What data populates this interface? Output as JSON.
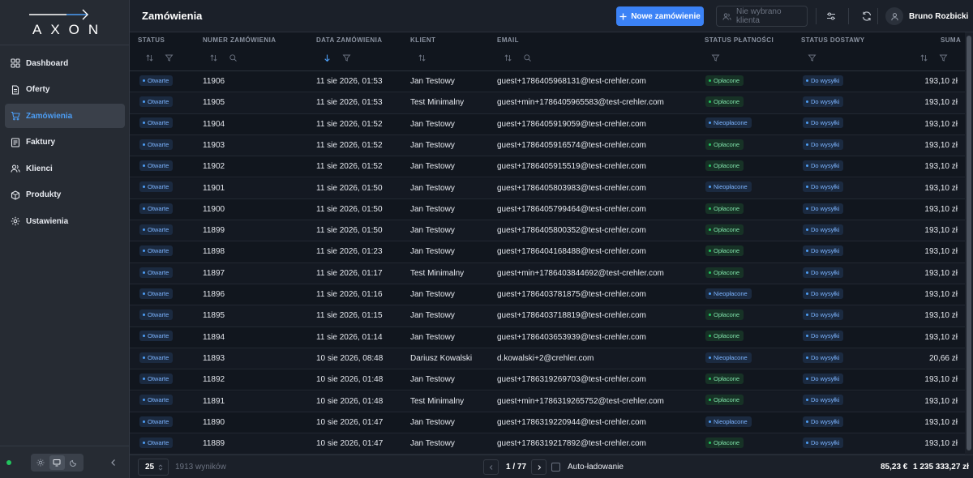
{
  "app": {
    "logo_text": "AXON"
  },
  "sidebar": {
    "items": [
      {
        "label": "Dashboard",
        "icon": "dashboard-icon",
        "active": false
      },
      {
        "label": "Oferty",
        "icon": "document-icon",
        "active": false
      },
      {
        "label": "Zamówienia",
        "icon": "cart-icon",
        "active": true
      },
      {
        "label": "Faktury",
        "icon": "invoice-icon",
        "active": false
      },
      {
        "label": "Klienci",
        "icon": "users-icon",
        "active": false
      },
      {
        "label": "Produkty",
        "icon": "package-icon",
        "active": false
      },
      {
        "label": "Ustawienia",
        "icon": "gear-icon",
        "active": false
      }
    ]
  },
  "header": {
    "title": "Zamówienia",
    "new_order_label": "Nowe zamówienie",
    "client_placeholder": "Nie wybrano klienta",
    "user_name": "Bruno Rozbicki"
  },
  "table": {
    "columns": {
      "status": "STATUS",
      "order_number": "NUMER ZAMÓWIENIA",
      "order_date": "DATA ZAMÓWIENIA",
      "client": "KLIENT",
      "email": "EMAIL",
      "payment_status": "STATUS PŁATNOŚCI",
      "delivery_status": "STATUS DOSTAWY",
      "sum": "SUMA"
    },
    "rows": [
      {
        "status": "Otwarte",
        "number": "11906",
        "date": "11 sie 2026, 01:53",
        "client": "Jan Testowy",
        "email": "guest+1786405968131@test-crehler.com",
        "payment": "Opłacone",
        "delivery": "Do wysyłki",
        "sum": "193,10 zł"
      },
      {
        "status": "Otwarte",
        "number": "11905",
        "date": "11 sie 2026, 01:53",
        "client": "Test Minimalny",
        "email": "guest+min+1786405965583@test-crehler.com",
        "payment": "Opłacone",
        "delivery": "Do wysyłki",
        "sum": "193,10 zł"
      },
      {
        "status": "Otwarte",
        "number": "11904",
        "date": "11 sie 2026, 01:52",
        "client": "Jan Testowy",
        "email": "guest+1786405919059@test-crehler.com",
        "payment": "Nieopłacone",
        "delivery": "Do wysyłki",
        "sum": "193,10 zł"
      },
      {
        "status": "Otwarte",
        "number": "11903",
        "date": "11 sie 2026, 01:52",
        "client": "Jan Testowy",
        "email": "guest+1786405916574@test-crehler.com",
        "payment": "Opłacone",
        "delivery": "Do wysyłki",
        "sum": "193,10 zł"
      },
      {
        "status": "Otwarte",
        "number": "11902",
        "date": "11 sie 2026, 01:52",
        "client": "Jan Testowy",
        "email": "guest+1786405915519@test-crehler.com",
        "payment": "Opłacone",
        "delivery": "Do wysyłki",
        "sum": "193,10 zł"
      },
      {
        "status": "Otwarte",
        "number": "11901",
        "date": "11 sie 2026, 01:50",
        "client": "Jan Testowy",
        "email": "guest+1786405803983@test-crehler.com",
        "payment": "Nieopłacone",
        "delivery": "Do wysyłki",
        "sum": "193,10 zł"
      },
      {
        "status": "Otwarte",
        "number": "11900",
        "date": "11 sie 2026, 01:50",
        "client": "Jan Testowy",
        "email": "guest+1786405799464@test-crehler.com",
        "payment": "Opłacone",
        "delivery": "Do wysyłki",
        "sum": "193,10 zł"
      },
      {
        "status": "Otwarte",
        "number": "11899",
        "date": "11 sie 2026, 01:50",
        "client": "Jan Testowy",
        "email": "guest+1786405800352@test-crehler.com",
        "payment": "Opłacone",
        "delivery": "Do wysyłki",
        "sum": "193,10 zł"
      },
      {
        "status": "Otwarte",
        "number": "11898",
        "date": "11 sie 2026, 01:23",
        "client": "Jan Testowy",
        "email": "guest+1786404168488@test-crehler.com",
        "payment": "Opłacone",
        "delivery": "Do wysyłki",
        "sum": "193,10 zł"
      },
      {
        "status": "Otwarte",
        "number": "11897",
        "date": "11 sie 2026, 01:17",
        "client": "Test Minimalny",
        "email": "guest+min+1786403844692@test-crehler.com",
        "payment": "Opłacone",
        "delivery": "Do wysyłki",
        "sum": "193,10 zł"
      },
      {
        "status": "Otwarte",
        "number": "11896",
        "date": "11 sie 2026, 01:16",
        "client": "Jan Testowy",
        "email": "guest+1786403781875@test-crehler.com",
        "payment": "Nieopłacone",
        "delivery": "Do wysyłki",
        "sum": "193,10 zł"
      },
      {
        "status": "Otwarte",
        "number": "11895",
        "date": "11 sie 2026, 01:15",
        "client": "Jan Testowy",
        "email": "guest+1786403718819@test-crehler.com",
        "payment": "Opłacone",
        "delivery": "Do wysyłki",
        "sum": "193,10 zł"
      },
      {
        "status": "Otwarte",
        "number": "11894",
        "date": "11 sie 2026, 01:14",
        "client": "Jan Testowy",
        "email": "guest+1786403653939@test-crehler.com",
        "payment": "Opłacone",
        "delivery": "Do wysyłki",
        "sum": "193,10 zł"
      },
      {
        "status": "Otwarte",
        "number": "11893",
        "date": "10 sie 2026, 08:48",
        "client": "Dariusz Kowalski",
        "email": "d.kowalski+2@crehler.com",
        "payment": "Nieopłacone",
        "delivery": "Do wysyłki",
        "sum": "20,66 zł"
      },
      {
        "status": "Otwarte",
        "number": "11892",
        "date": "10 sie 2026, 01:48",
        "client": "Jan Testowy",
        "email": "guest+1786319269703@test-crehler.com",
        "payment": "Opłacone",
        "delivery": "Do wysyłki",
        "sum": "193,10 zł"
      },
      {
        "status": "Otwarte",
        "number": "11891",
        "date": "10 sie 2026, 01:48",
        "client": "Test Minimalny",
        "email": "guest+min+1786319265752@test-crehler.com",
        "payment": "Opłacone",
        "delivery": "Do wysyłki",
        "sum": "193,10 zł"
      },
      {
        "status": "Otwarte",
        "number": "11890",
        "date": "10 sie 2026, 01:47",
        "client": "Jan Testowy",
        "email": "guest+1786319220944@test-crehler.com",
        "payment": "Nieopłacone",
        "delivery": "Do wysyłki",
        "sum": "193,10 zł"
      },
      {
        "status": "Otwarte",
        "number": "11889",
        "date": "10 sie 2026, 01:47",
        "client": "Jan Testowy",
        "email": "guest+1786319217892@test-crehler.com",
        "payment": "Opłacone",
        "delivery": "Do wysyłki",
        "sum": "193,10 zł"
      }
    ]
  },
  "footer": {
    "per_page": "25",
    "results": "1913 wyników",
    "page": "1 / 77",
    "auto_load_label": "Auto-ładowanie",
    "sum_eur": "85,23 €",
    "sum_pln": "1 235 333,27 zł"
  },
  "colors": {
    "accent": "#3b82f6",
    "active_nav_text": "#4c9df4",
    "paid_badge": "#22c55e",
    "status_badge": "#4c9df4",
    "online_dot": "#22c55e"
  }
}
